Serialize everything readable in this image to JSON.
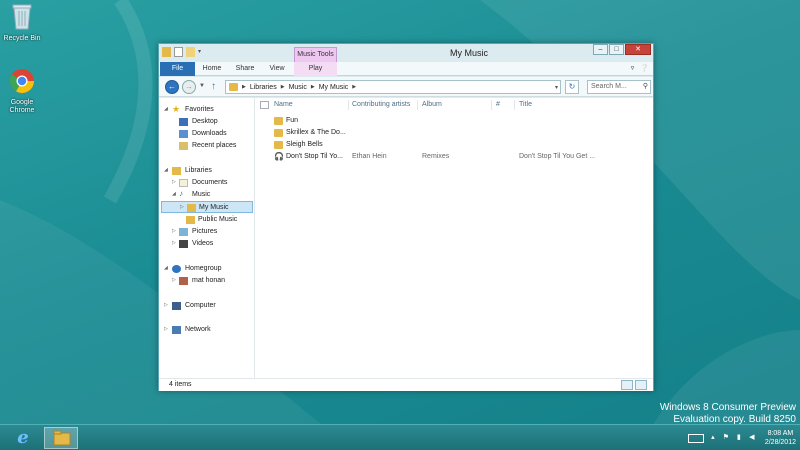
{
  "desktop": {
    "icons": [
      {
        "label": "Recycle Bin"
      },
      {
        "label": "Google Chrome"
      }
    ],
    "watermark": {
      "line1": "Windows 8 Consumer Preview",
      "line2": "Evaluation copy. Build 8250"
    }
  },
  "window": {
    "title": "My Music",
    "context_tab": "Music Tools",
    "ribbon_tabs": [
      "File",
      "Home",
      "Share",
      "View",
      "Play"
    ],
    "controls": {
      "minimize": "–",
      "maximize": "□",
      "close": "✕"
    },
    "address": {
      "crumbs": [
        "Libraries",
        "Music",
        "My Music"
      ],
      "search_placeholder": "Search M..."
    },
    "nav": {
      "favorites": {
        "label": "Favorites",
        "items": [
          "Desktop",
          "Downloads",
          "Recent places"
        ]
      },
      "libraries": {
        "label": "Libraries",
        "items": [
          "Documents",
          "Music",
          "My Music",
          "Public Music",
          "Pictures",
          "Videos"
        ]
      },
      "homegroup": {
        "label": "Homegroup",
        "items": [
          "mat honan"
        ]
      },
      "computer": {
        "label": "Computer"
      },
      "network": {
        "label": "Network"
      }
    },
    "columns": [
      "Name",
      "Contributing artists",
      "Album",
      "#",
      "Title"
    ],
    "files": [
      {
        "name": "Fun",
        "type": "folder",
        "artist": "",
        "album": "",
        "num": "",
        "title": ""
      },
      {
        "name": "Skrillex & The Do...",
        "type": "folder",
        "artist": "",
        "album": "",
        "num": "",
        "title": ""
      },
      {
        "name": "Sleigh Bells",
        "type": "folder",
        "artist": "",
        "album": "",
        "num": "",
        "title": ""
      },
      {
        "name": "Don't Stop Til Yo...",
        "type": "audio",
        "artist": "Ethan Hein",
        "album": "Remixes",
        "num": "",
        "title": "Don't Stop Til You Get ..."
      }
    ],
    "status": {
      "item_count": "4 items"
    }
  },
  "taskbar": {
    "clock_time": "8:08 AM",
    "clock_date": "2/28/2012"
  },
  "colors": {
    "desktop_bg": "#1a8c93",
    "file_tab": "#2a6fb3",
    "music_tools": "#eec8f0",
    "close_button": "#c7423a",
    "selection": "#cce6f5",
    "folder": "#e4b94a"
  }
}
